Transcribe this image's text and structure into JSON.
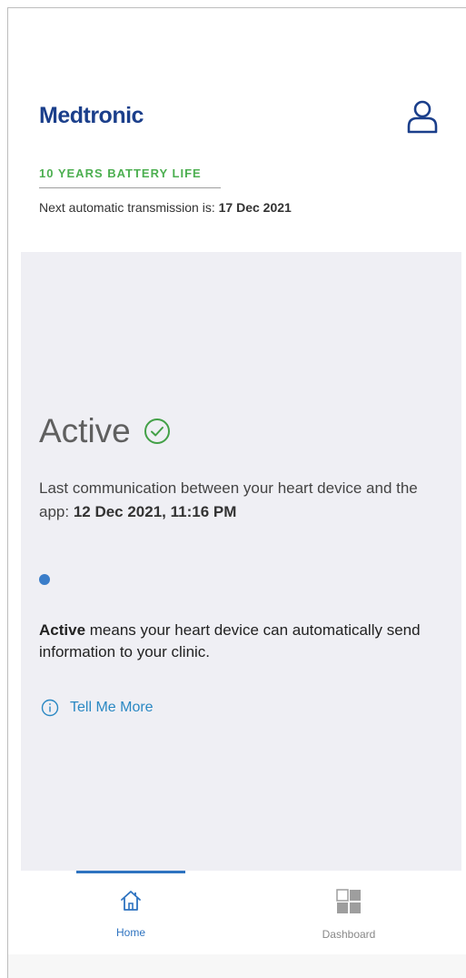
{
  "header": {
    "logo_text": "Medtronic",
    "profile_icon": "user-icon",
    "battery_text": "10 YEARS BATTERY LIFE",
    "next_transmission_prefix": "Next automatic transmission is: ",
    "next_transmission_date": "17 Dec 2021"
  },
  "status": {
    "title": "Active",
    "title_icon": "check-circle-icon",
    "last_comm_prefix": "Last communication between your heart device and the app: ",
    "last_comm_value": "12 Dec 2021, 11:16 PM",
    "description_bold": "Active",
    "description_rest": " means your heart device can automatically send information to your clinic.",
    "tell_more_label": "Tell Me More",
    "tell_more_icon": "info-icon"
  },
  "tabs": [
    {
      "label": "Home",
      "icon": "home-icon",
      "selected": true
    },
    {
      "label": "Dashboard",
      "icon": "dashboard-icon",
      "selected": false
    }
  ],
  "colors": {
    "brand_blue": "#1b3f8b",
    "accent_blue": "#2e73c0",
    "battery_green": "#4caf50",
    "check_green": "#43a047",
    "link_blue": "#2a88c3",
    "card_bg": "#efeff4"
  }
}
